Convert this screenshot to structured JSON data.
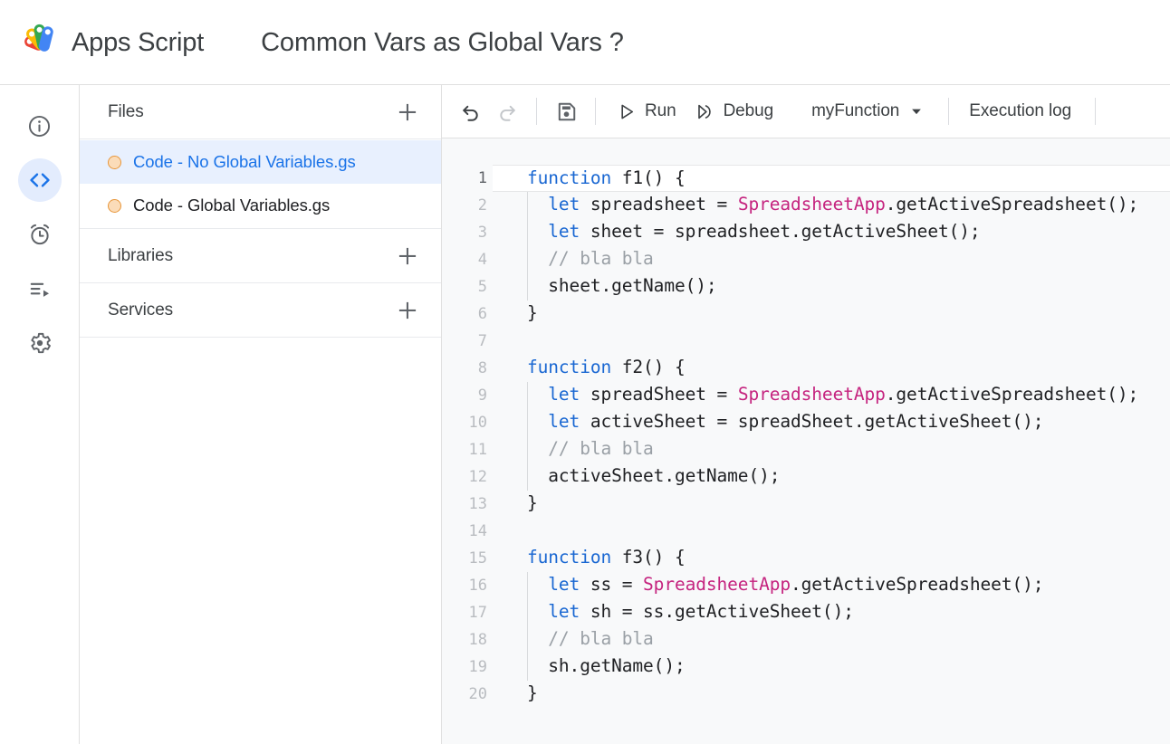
{
  "header": {
    "brand_name": "Apps Script",
    "logo_icon": "apps-script-logo",
    "doc_title": "Common Vars as Global Vars ?"
  },
  "rail": {
    "items": [
      {
        "icon": "info-circle-icon",
        "name": "overview",
        "selected": false
      },
      {
        "icon": "code-brackets-icon",
        "name": "editor",
        "selected": true
      },
      {
        "icon": "alarm-clock-icon",
        "name": "triggers",
        "selected": false
      },
      {
        "icon": "executions-list-icon",
        "name": "executions",
        "selected": false
      },
      {
        "icon": "gear-icon",
        "name": "project-settings",
        "selected": false
      }
    ]
  },
  "panel": {
    "files_section": {
      "title": "Files",
      "add_icon": "plus-icon"
    },
    "files": [
      {
        "name": "Code - No Global Variables.gs",
        "icon": "file-circle-icon",
        "active": true
      },
      {
        "name": "Code - Global Variables.gs",
        "icon": "file-circle-icon",
        "active": false
      }
    ],
    "libraries_section": {
      "title": "Libraries",
      "add_icon": "plus-icon"
    },
    "services_section": {
      "title": "Services",
      "add_icon": "plus-icon"
    }
  },
  "toolbar": {
    "undo_icon": "undo-arrow-icon",
    "redo_icon": "redo-arrow-icon",
    "save_icon": "floppy-disk-save-icon",
    "run_label": "Run",
    "run_icon": "play-triangle-icon",
    "debug_label": "Debug",
    "debug_icon": "debug-step-icon",
    "function_select_value": "myFunction",
    "function_select_icon": "chevron-down-icon",
    "execution_log_label": "Execution log"
  },
  "colors": {
    "accent_blue": "#1a73e8",
    "keyword_blue": "#1967d2",
    "class_pink": "#c5247f",
    "comment_gray": "#9aa0a6",
    "text_dark": "#202124",
    "selected_row_bg": "#e8f0fe",
    "file_icon_orange": "#e8963a",
    "editor_bg": "#f8f9fa"
  },
  "code": {
    "active_line": 1,
    "lines": [
      {
        "n": "1",
        "indent": false,
        "tokens": [
          {
            "t": "kw",
            "v": "function"
          },
          {
            "t": "pln",
            "v": " f1() {"
          }
        ]
      },
      {
        "n": "2",
        "indent": true,
        "tokens": [
          {
            "t": "pln",
            "v": "  "
          },
          {
            "t": "kw",
            "v": "let"
          },
          {
            "t": "pln",
            "v": " spreadsheet = "
          },
          {
            "t": "cls",
            "v": "SpreadsheetApp"
          },
          {
            "t": "pln",
            "v": ".getActiveSpreadsheet();"
          }
        ]
      },
      {
        "n": "3",
        "indent": true,
        "tokens": [
          {
            "t": "pln",
            "v": "  "
          },
          {
            "t": "kw",
            "v": "let"
          },
          {
            "t": "pln",
            "v": " sheet = spreadsheet.getActiveSheet();"
          }
        ]
      },
      {
        "n": "4",
        "indent": true,
        "tokens": [
          {
            "t": "pln",
            "v": "  "
          },
          {
            "t": "cmt",
            "v": "// bla bla"
          }
        ]
      },
      {
        "n": "5",
        "indent": true,
        "tokens": [
          {
            "t": "pln",
            "v": "  sheet.getName();"
          }
        ]
      },
      {
        "n": "6",
        "indent": false,
        "tokens": [
          {
            "t": "pln",
            "v": "}"
          }
        ]
      },
      {
        "n": "7",
        "indent": false,
        "tokens": [
          {
            "t": "pln",
            "v": ""
          }
        ]
      },
      {
        "n": "8",
        "indent": false,
        "tokens": [
          {
            "t": "kw",
            "v": "function"
          },
          {
            "t": "pln",
            "v": " f2() {"
          }
        ]
      },
      {
        "n": "9",
        "indent": true,
        "tokens": [
          {
            "t": "pln",
            "v": "  "
          },
          {
            "t": "kw",
            "v": "let"
          },
          {
            "t": "pln",
            "v": " spreadSheet = "
          },
          {
            "t": "cls",
            "v": "SpreadsheetApp"
          },
          {
            "t": "pln",
            "v": ".getActiveSpreadsheet();"
          }
        ]
      },
      {
        "n": "10",
        "indent": true,
        "tokens": [
          {
            "t": "pln",
            "v": "  "
          },
          {
            "t": "kw",
            "v": "let"
          },
          {
            "t": "pln",
            "v": " activeSheet = spreadSheet.getActiveSheet();"
          }
        ]
      },
      {
        "n": "11",
        "indent": true,
        "tokens": [
          {
            "t": "pln",
            "v": "  "
          },
          {
            "t": "cmt",
            "v": "// bla bla"
          }
        ]
      },
      {
        "n": "12",
        "indent": true,
        "tokens": [
          {
            "t": "pln",
            "v": "  activeSheet.getName();"
          }
        ]
      },
      {
        "n": "13",
        "indent": false,
        "tokens": [
          {
            "t": "pln",
            "v": "}"
          }
        ]
      },
      {
        "n": "14",
        "indent": false,
        "tokens": [
          {
            "t": "pln",
            "v": ""
          }
        ]
      },
      {
        "n": "15",
        "indent": false,
        "tokens": [
          {
            "t": "kw",
            "v": "function"
          },
          {
            "t": "pln",
            "v": " f3() {"
          }
        ]
      },
      {
        "n": "16",
        "indent": true,
        "tokens": [
          {
            "t": "pln",
            "v": "  "
          },
          {
            "t": "kw",
            "v": "let"
          },
          {
            "t": "pln",
            "v": " ss = "
          },
          {
            "t": "cls",
            "v": "SpreadsheetApp"
          },
          {
            "t": "pln",
            "v": ".getActiveSpreadsheet();"
          }
        ]
      },
      {
        "n": "17",
        "indent": true,
        "tokens": [
          {
            "t": "pln",
            "v": "  "
          },
          {
            "t": "kw",
            "v": "let"
          },
          {
            "t": "pln",
            "v": " sh = ss.getActiveSheet();"
          }
        ]
      },
      {
        "n": "18",
        "indent": true,
        "tokens": [
          {
            "t": "pln",
            "v": "  "
          },
          {
            "t": "cmt",
            "v": "// bla bla"
          }
        ]
      },
      {
        "n": "19",
        "indent": true,
        "tokens": [
          {
            "t": "pln",
            "v": "  sh.getName();"
          }
        ]
      },
      {
        "n": "20",
        "indent": false,
        "tokens": [
          {
            "t": "pln",
            "v": "}"
          }
        ]
      }
    ]
  }
}
